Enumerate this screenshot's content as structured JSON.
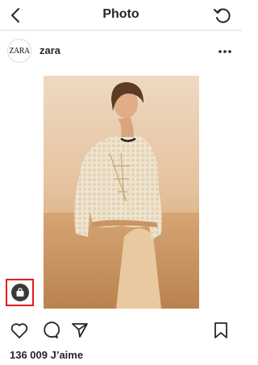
{
  "topbar": {
    "title": "Photo"
  },
  "post": {
    "username": "zara",
    "avatar_text": "ZARA",
    "likes_text": "136 009 J’aime"
  },
  "icons": {
    "back": "chevron-left-icon",
    "refresh": "refresh-icon",
    "more": "more-horizontal-icon",
    "shop": "shopping-bag-icon",
    "like": "heart-icon",
    "comment": "comment-icon",
    "share": "paper-plane-icon",
    "save": "bookmark-icon"
  },
  "colors": {
    "highlight_box": "#e01d1d",
    "text": "#262626",
    "divider": "#dbdbdb"
  }
}
